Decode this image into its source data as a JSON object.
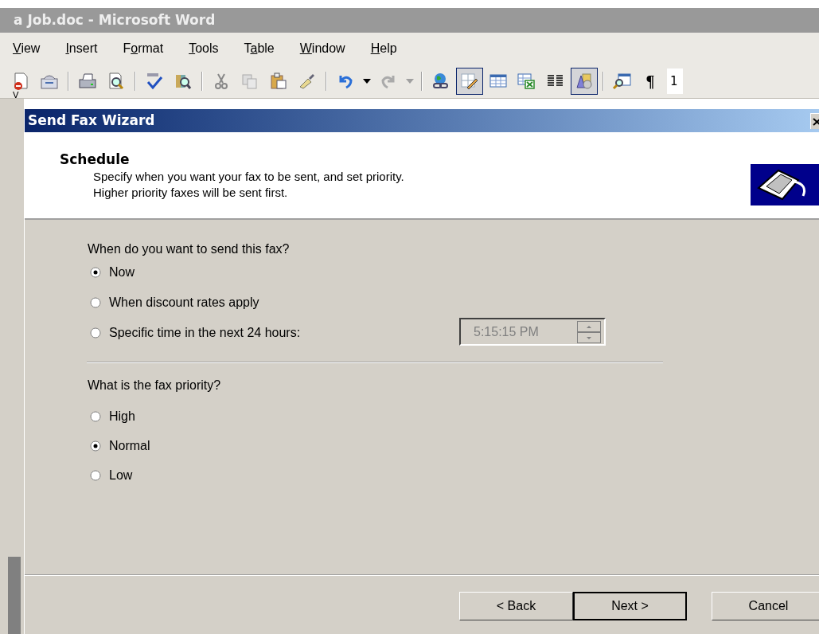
{
  "app_window": {
    "title": "a Job.doc - Microsoft Word"
  },
  "menu": [
    {
      "key": "V",
      "rest": "iew"
    },
    {
      "key": "I",
      "rest": "nsert"
    },
    {
      "lead": "F",
      "key": "o",
      "rest": "rmat"
    },
    {
      "key": "T",
      "rest": "ools"
    },
    {
      "lead": "T",
      "key": "a",
      "rest": "ble"
    },
    {
      "key": "W",
      "rest": "indow"
    },
    {
      "key": "H",
      "rest": "elp"
    }
  ],
  "toolbar": [
    {
      "kind": "button",
      "pressed": false
    },
    {
      "kind": "button",
      "pressed": false
    },
    {
      "kind": "separator"
    },
    {
      "kind": "button",
      "pressed": false
    },
    {
      "kind": "button",
      "pressed": false
    },
    {
      "kind": "separator"
    },
    {
      "kind": "button",
      "pressed": false
    },
    {
      "kind": "button",
      "pressed": false
    },
    {
      "kind": "separator"
    },
    {
      "kind": "button",
      "pressed": false
    },
    {
      "kind": "button",
      "pressed": false
    },
    {
      "kind": "button",
      "pressed": false
    },
    {
      "kind": "button",
      "pressed": false
    },
    {
      "kind": "separator"
    },
    {
      "kind": "button",
      "pressed": false
    },
    {
      "kind": "dropdown",
      "disabled": false
    },
    {
      "kind": "button",
      "pressed": false
    },
    {
      "kind": "dropdown",
      "disabled": true
    },
    {
      "kind": "separator"
    },
    {
      "kind": "button",
      "pressed": false
    },
    {
      "kind": "button",
      "pressed": true
    },
    {
      "kind": "button",
      "pressed": false
    },
    {
      "kind": "button",
      "pressed": false
    },
    {
      "kind": "button",
      "pressed": false
    },
    {
      "kind": "button",
      "pressed": true
    },
    {
      "kind": "separator"
    },
    {
      "kind": "button",
      "pressed": false
    },
    {
      "kind": "glyph",
      "text": "¶"
    }
  ],
  "zoom_box": "1",
  "document_edge": "V",
  "dialog": {
    "title": "Send Fax Wizard",
    "header": {
      "title": "Schedule",
      "lines": [
        "Specify when you want your fax to be sent, and set priority.",
        "Higher priority faxes will be sent first."
      ]
    },
    "when": {
      "question": "When do you want to send this fax?",
      "options": [
        {
          "label": "Now",
          "selected": true
        },
        {
          "label": "When discount rates apply",
          "selected": false
        },
        {
          "label": "Specific time in the next 24 hours:",
          "selected": false
        }
      ],
      "time_field": {
        "value": "5:15:15 PM",
        "disabled": true
      }
    },
    "priority": {
      "question": "What is the fax priority?",
      "options": [
        {
          "label": "High",
          "selected": false
        },
        {
          "label": "Normal",
          "selected": true
        },
        {
          "label": "Low",
          "selected": false
        }
      ]
    },
    "buttons": [
      {
        "label": "< Back",
        "default": false
      },
      {
        "label": "Next >",
        "default": true
      },
      {
        "label": "Cancel",
        "default": false
      }
    ]
  }
}
